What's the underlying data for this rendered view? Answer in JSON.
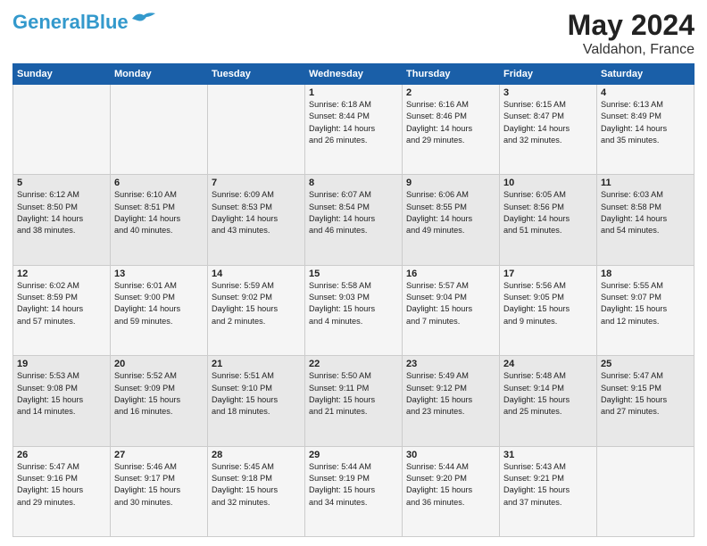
{
  "header": {
    "logo_line1": "General",
    "logo_line2": "Blue",
    "month": "May 2024",
    "location": "Valdahon, France"
  },
  "weekdays": [
    "Sunday",
    "Monday",
    "Tuesday",
    "Wednesday",
    "Thursday",
    "Friday",
    "Saturday"
  ],
  "weeks": [
    [
      {
        "day": "",
        "info": ""
      },
      {
        "day": "",
        "info": ""
      },
      {
        "day": "",
        "info": ""
      },
      {
        "day": "1",
        "info": "Sunrise: 6:18 AM\nSunset: 8:44 PM\nDaylight: 14 hours\nand 26 minutes."
      },
      {
        "day": "2",
        "info": "Sunrise: 6:16 AM\nSunset: 8:46 PM\nDaylight: 14 hours\nand 29 minutes."
      },
      {
        "day": "3",
        "info": "Sunrise: 6:15 AM\nSunset: 8:47 PM\nDaylight: 14 hours\nand 32 minutes."
      },
      {
        "day": "4",
        "info": "Sunrise: 6:13 AM\nSunset: 8:49 PM\nDaylight: 14 hours\nand 35 minutes."
      }
    ],
    [
      {
        "day": "5",
        "info": "Sunrise: 6:12 AM\nSunset: 8:50 PM\nDaylight: 14 hours\nand 38 minutes."
      },
      {
        "day": "6",
        "info": "Sunrise: 6:10 AM\nSunset: 8:51 PM\nDaylight: 14 hours\nand 40 minutes."
      },
      {
        "day": "7",
        "info": "Sunrise: 6:09 AM\nSunset: 8:53 PM\nDaylight: 14 hours\nand 43 minutes."
      },
      {
        "day": "8",
        "info": "Sunrise: 6:07 AM\nSunset: 8:54 PM\nDaylight: 14 hours\nand 46 minutes."
      },
      {
        "day": "9",
        "info": "Sunrise: 6:06 AM\nSunset: 8:55 PM\nDaylight: 14 hours\nand 49 minutes."
      },
      {
        "day": "10",
        "info": "Sunrise: 6:05 AM\nSunset: 8:56 PM\nDaylight: 14 hours\nand 51 minutes."
      },
      {
        "day": "11",
        "info": "Sunrise: 6:03 AM\nSunset: 8:58 PM\nDaylight: 14 hours\nand 54 minutes."
      }
    ],
    [
      {
        "day": "12",
        "info": "Sunrise: 6:02 AM\nSunset: 8:59 PM\nDaylight: 14 hours\nand 57 minutes."
      },
      {
        "day": "13",
        "info": "Sunrise: 6:01 AM\nSunset: 9:00 PM\nDaylight: 14 hours\nand 59 minutes."
      },
      {
        "day": "14",
        "info": "Sunrise: 5:59 AM\nSunset: 9:02 PM\nDaylight: 15 hours\nand 2 minutes."
      },
      {
        "day": "15",
        "info": "Sunrise: 5:58 AM\nSunset: 9:03 PM\nDaylight: 15 hours\nand 4 minutes."
      },
      {
        "day": "16",
        "info": "Sunrise: 5:57 AM\nSunset: 9:04 PM\nDaylight: 15 hours\nand 7 minutes."
      },
      {
        "day": "17",
        "info": "Sunrise: 5:56 AM\nSunset: 9:05 PM\nDaylight: 15 hours\nand 9 minutes."
      },
      {
        "day": "18",
        "info": "Sunrise: 5:55 AM\nSunset: 9:07 PM\nDaylight: 15 hours\nand 12 minutes."
      }
    ],
    [
      {
        "day": "19",
        "info": "Sunrise: 5:53 AM\nSunset: 9:08 PM\nDaylight: 15 hours\nand 14 minutes."
      },
      {
        "day": "20",
        "info": "Sunrise: 5:52 AM\nSunset: 9:09 PM\nDaylight: 15 hours\nand 16 minutes."
      },
      {
        "day": "21",
        "info": "Sunrise: 5:51 AM\nSunset: 9:10 PM\nDaylight: 15 hours\nand 18 minutes."
      },
      {
        "day": "22",
        "info": "Sunrise: 5:50 AM\nSunset: 9:11 PM\nDaylight: 15 hours\nand 21 minutes."
      },
      {
        "day": "23",
        "info": "Sunrise: 5:49 AM\nSunset: 9:12 PM\nDaylight: 15 hours\nand 23 minutes."
      },
      {
        "day": "24",
        "info": "Sunrise: 5:48 AM\nSunset: 9:14 PM\nDaylight: 15 hours\nand 25 minutes."
      },
      {
        "day": "25",
        "info": "Sunrise: 5:47 AM\nSunset: 9:15 PM\nDaylight: 15 hours\nand 27 minutes."
      }
    ],
    [
      {
        "day": "26",
        "info": "Sunrise: 5:47 AM\nSunset: 9:16 PM\nDaylight: 15 hours\nand 29 minutes."
      },
      {
        "day": "27",
        "info": "Sunrise: 5:46 AM\nSunset: 9:17 PM\nDaylight: 15 hours\nand 30 minutes."
      },
      {
        "day": "28",
        "info": "Sunrise: 5:45 AM\nSunset: 9:18 PM\nDaylight: 15 hours\nand 32 minutes."
      },
      {
        "day": "29",
        "info": "Sunrise: 5:44 AM\nSunset: 9:19 PM\nDaylight: 15 hours\nand 34 minutes."
      },
      {
        "day": "30",
        "info": "Sunrise: 5:44 AM\nSunset: 9:20 PM\nDaylight: 15 hours\nand 36 minutes."
      },
      {
        "day": "31",
        "info": "Sunrise: 5:43 AM\nSunset: 9:21 PM\nDaylight: 15 hours\nand 37 minutes."
      },
      {
        "day": "",
        "info": ""
      }
    ]
  ]
}
